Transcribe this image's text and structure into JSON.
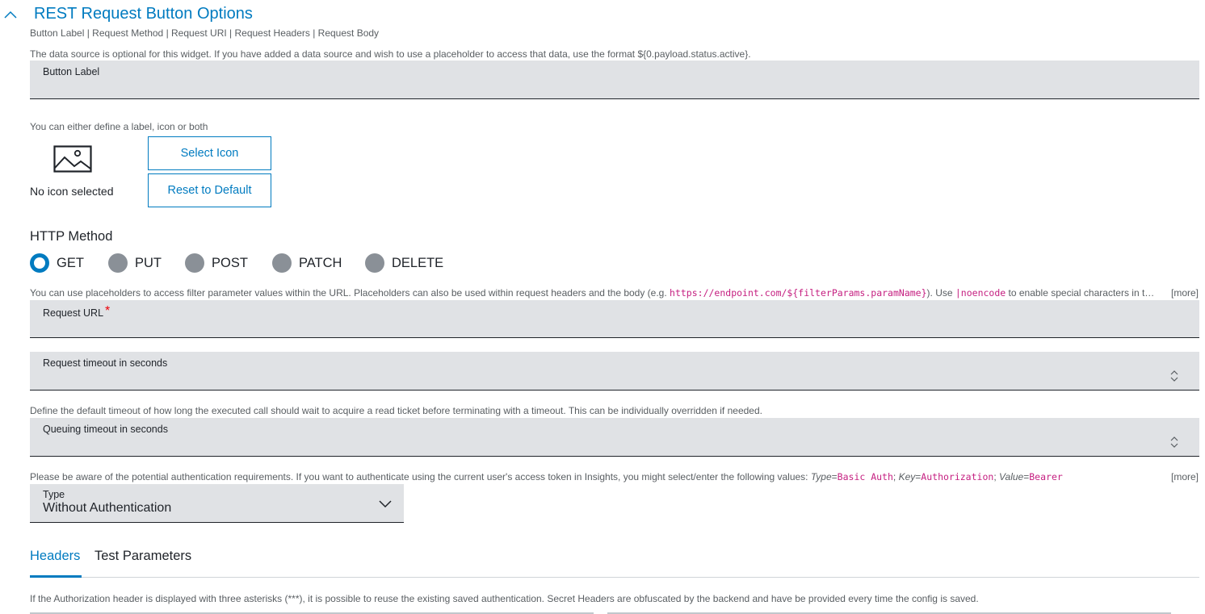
{
  "section": {
    "title": "REST Request Button Options",
    "subtitle": "Button Label | Request Method | Request URI | Request Headers | Request Body",
    "datasource_hint": "The data source is optional for this widget. If you have added a data source and wish to use a placeholder to access that data, use the format ${0.payload.status.active}."
  },
  "button_label_field": {
    "label": "Button Label",
    "value": ""
  },
  "icon_section": {
    "hint": "You can either define a label, icon or both",
    "no_icon_text": "No icon selected",
    "select_icon_label": "Select Icon",
    "reset_label": "Reset to Default"
  },
  "http_method": {
    "label": "HTTP Method",
    "options": [
      "GET",
      "PUT",
      "POST",
      "PATCH",
      "DELETE"
    ],
    "selected": "GET"
  },
  "url_hint": {
    "part1": "You can use placeholders to access filter parameter values within the URL. Placeholders can also be used within request headers and the body (e.g. ",
    "code1": "https://endpoint.com/${filterParams.paramName}",
    "part2": "). Use ",
    "code2": "|noencode",
    "part3": " to enable special characters in the URL.",
    "more": "[more]"
  },
  "request_url_field": {
    "label": "Request URL",
    "required_mark": "*",
    "value": ""
  },
  "request_timeout_field": {
    "label": "Request timeout in seconds",
    "value": ""
  },
  "queue_hint": "Define the default timeout of how long the executed call should wait to acquire a read ticket before terminating with a timeout. This can be individually overridden if needed.",
  "queue_timeout_field": {
    "label": "Queuing timeout in seconds",
    "value": ""
  },
  "auth_hint": {
    "part1": "Please be aware of the potential authentication requirements. If you want to authenticate using the current user's access token in Insights, you might select/enter the following values: ",
    "k1": "Type",
    "eq": "=",
    "v1": "Basic Auth",
    "sep": "; ",
    "k2": "Key",
    "v2": "Authorization",
    "k3": "Value",
    "v3": "Bearer",
    "more": "[more]"
  },
  "type_select": {
    "label": "Type",
    "value": "Without Authentication"
  },
  "tabs": [
    {
      "label": "Headers",
      "active": true
    },
    {
      "label": "Test Parameters",
      "active": false
    }
  ],
  "headers_hint": "If the Authorization header is displayed with three asterisks (***), it is possible to reuse the existing saved authentication. Secret Headers are obfuscated by the backend and have be provided every time the config is saved.",
  "colors": {
    "accent": "#007bc0",
    "field_bg": "#e0e2e5",
    "code": "#c51f80",
    "required": "#ed0007",
    "radio_off": "#8a9097"
  }
}
